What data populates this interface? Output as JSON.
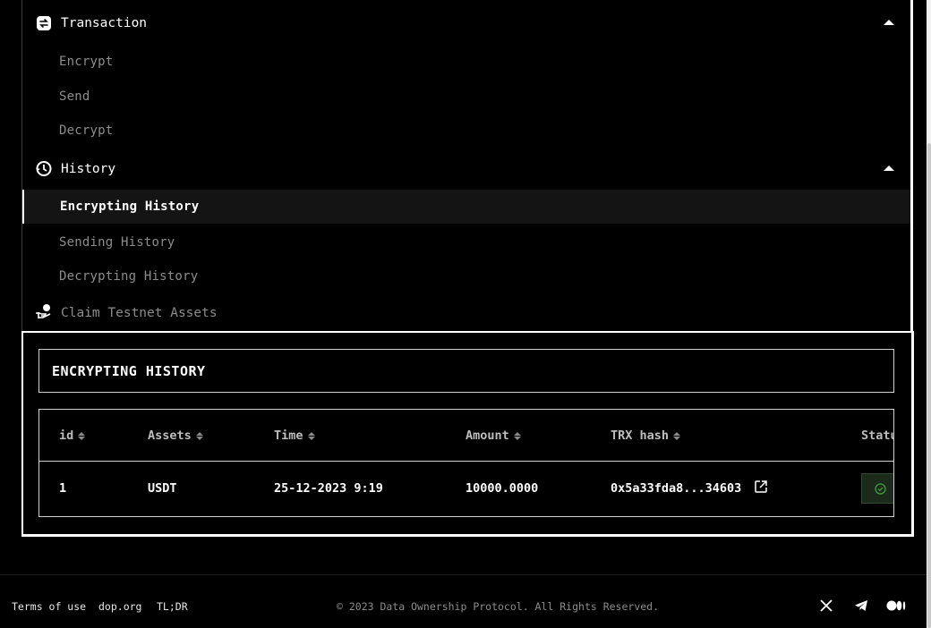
{
  "sidebar": {
    "groups": [
      {
        "label": "Transaction",
        "icon": "transaction-icon",
        "expanded": true
      },
      {
        "label": "History",
        "icon": "history-icon",
        "expanded": true
      }
    ],
    "transaction_items": [
      "Encrypt",
      "Send",
      "Decrypt"
    ],
    "history_items": [
      "Encrypting History",
      "Sending History",
      "Decrypting History"
    ],
    "active_item": "Encrypting History",
    "claim_label": "Claim Testnet Assets"
  },
  "main": {
    "title": "ENCRYPTING HISTORY",
    "columns": [
      "id",
      "Assets",
      "Time",
      "Amount",
      "TRX hash",
      "Statu"
    ],
    "rows": [
      {
        "id": "1",
        "asset": "USDT",
        "time": "25-12-2023 9:19",
        "amount": "10000.0000",
        "hash": "0x5a33fda8...34603",
        "status_icon": "check-circle-icon"
      }
    ]
  },
  "footer": {
    "links": [
      "Terms of use",
      "dop.org",
      "TL;DR"
    ],
    "copyright": "© 2023 Data Ownership Protocol. All Rights Reserved.",
    "social": [
      "x-icon",
      "telegram-icon",
      "medium-icon"
    ]
  },
  "colors": {
    "background": "#000000",
    "text": "#ffffff",
    "muted": "#8c8c8c",
    "active_row": "#141414",
    "status_green": "#2e7d32"
  }
}
